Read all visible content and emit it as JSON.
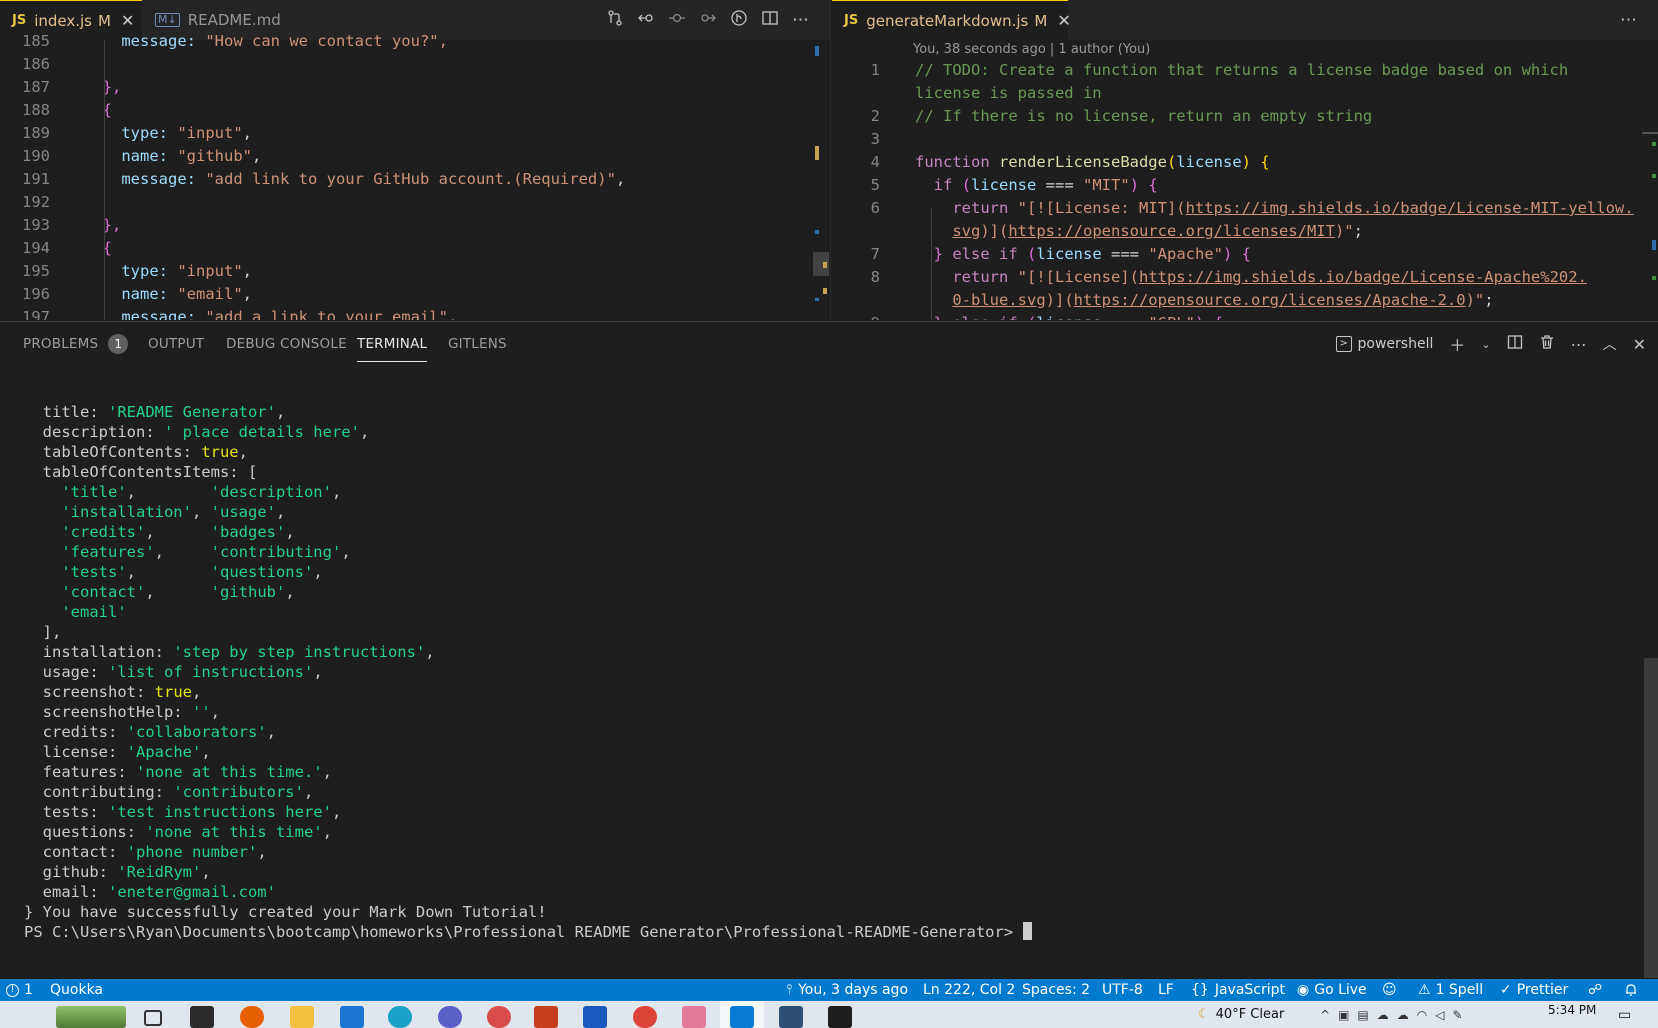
{
  "left_editor": {
    "tabs": [
      {
        "lang": "JS",
        "name": "index.js",
        "status": "M",
        "close": "✕",
        "active": true
      },
      {
        "lang": "M↓",
        "name": "README.md",
        "status": "",
        "close": "",
        "active": false
      }
    ],
    "lines": [
      {
        "n": "185",
        "segs": [
          {
            "t": "    message: ",
            "c": "var"
          },
          {
            "t": "\"How can we contact you?\",",
            "c": "str"
          }
        ]
      },
      {
        "n": "186",
        "segs": []
      },
      {
        "n": "187",
        "segs": [
          {
            "t": "  },",
            "c": "bkt"
          }
        ]
      },
      {
        "n": "188",
        "segs": [
          {
            "t": "  {",
            "c": "bkt"
          }
        ]
      },
      {
        "n": "189",
        "segs": [
          {
            "t": "    type: ",
            "c": "var"
          },
          {
            "t": "\"input\"",
            "c": "str"
          },
          {
            "t": ",",
            "c": "ws"
          }
        ]
      },
      {
        "n": "190",
        "segs": [
          {
            "t": "    name: ",
            "c": "var"
          },
          {
            "t": "\"github\"",
            "c": "str"
          },
          {
            "t": ",",
            "c": "ws"
          }
        ]
      },
      {
        "n": "191",
        "segs": [
          {
            "t": "    message: ",
            "c": "var"
          },
          {
            "t": "\"add link to your GitHub account.(Required)\"",
            "c": "str"
          },
          {
            "t": ",",
            "c": "ws"
          }
        ]
      },
      {
        "n": "192",
        "segs": []
      },
      {
        "n": "193",
        "segs": [
          {
            "t": "  },",
            "c": "bkt"
          }
        ]
      },
      {
        "n": "194",
        "segs": [
          {
            "t": "  {",
            "c": "bkt"
          }
        ]
      },
      {
        "n": "195",
        "segs": [
          {
            "t": "    type: ",
            "c": "var"
          },
          {
            "t": "\"input\"",
            "c": "str"
          },
          {
            "t": ",",
            "c": "ws"
          }
        ]
      },
      {
        "n": "196",
        "segs": [
          {
            "t": "    name: ",
            "c": "var"
          },
          {
            "t": "\"email\"",
            "c": "str"
          },
          {
            "t": ",",
            "c": "ws"
          }
        ]
      },
      {
        "n": "197",
        "segs": [
          {
            "t": "    message: ",
            "c": "var"
          },
          {
            "t": "\"add a link to your email\"",
            "c": "str"
          },
          {
            "t": ",",
            "c": "ws"
          }
        ]
      }
    ]
  },
  "right_editor": {
    "tab": {
      "lang": "JS",
      "name": "generateMarkdown.js",
      "status": "M",
      "close": "✕"
    },
    "codelens": "You, 38 seconds ago | 1 author (You)",
    "lines": [
      {
        "n": "1",
        "segs": [
          {
            "t": "// TODO: Create a function that returns a license badge based on which",
            "c": "cmt"
          }
        ]
      },
      {
        "n": "",
        "segs": [
          {
            "t": "license is passed in",
            "c": "cmt"
          }
        ]
      },
      {
        "n": "2",
        "segs": [
          {
            "t": "// If there is no license, return an empty string",
            "c": "cmt"
          }
        ]
      },
      {
        "n": "3",
        "segs": []
      },
      {
        "n": "4",
        "segs": [
          {
            "t": "function ",
            "c": "kw"
          },
          {
            "t": "renderLicenseBadge",
            "c": "fn"
          },
          {
            "t": "(",
            "c": "bkt2"
          },
          {
            "t": "license",
            "c": "var"
          },
          {
            "t": ") {",
            "c": "bkt2"
          }
        ]
      },
      {
        "n": "5",
        "segs": [
          {
            "t": "  if ",
            "c": "kw"
          },
          {
            "t": "(",
            "c": "bkt"
          },
          {
            "t": "license",
            "c": "var"
          },
          {
            "t": " === ",
            "c": "ws"
          },
          {
            "t": "\"MIT\"",
            "c": "str"
          },
          {
            "t": ") {",
            "c": "bkt"
          }
        ]
      },
      {
        "n": "6",
        "segs": [
          {
            "t": "    return ",
            "c": "kw"
          },
          {
            "t": "\"[![License: MIT](",
            "c": "str"
          },
          {
            "t": "https://img.shields.io/badge/License-MIT-yellow.",
            "c": "url"
          }
        ]
      },
      {
        "n": "",
        "segs": [
          {
            "t": "    ",
            "c": "ws"
          },
          {
            "t": "svg",
            "c": "url"
          },
          {
            "t": ")](",
            "c": "str"
          },
          {
            "t": "https://opensource.org/licenses/MIT",
            "c": "url"
          },
          {
            "t": ")\"",
            "c": "str"
          },
          {
            "t": ";",
            "c": "ws"
          }
        ]
      },
      {
        "n": "7",
        "segs": [
          {
            "t": "  } ",
            "c": "bkt"
          },
          {
            "t": "else if ",
            "c": "kw"
          },
          {
            "t": "(",
            "c": "bkt"
          },
          {
            "t": "license",
            "c": "var"
          },
          {
            "t": " === ",
            "c": "ws"
          },
          {
            "t": "\"Apache\"",
            "c": "str"
          },
          {
            "t": ") {",
            "c": "bkt"
          }
        ]
      },
      {
        "n": "8",
        "segs": [
          {
            "t": "    return ",
            "c": "kw"
          },
          {
            "t": "\"[![License](",
            "c": "str"
          },
          {
            "t": "https://img.shields.io/badge/License-Apache%202.",
            "c": "url"
          }
        ]
      },
      {
        "n": "",
        "segs": [
          {
            "t": "    ",
            "c": "ws"
          },
          {
            "t": "0-blue.svg",
            "c": "url"
          },
          {
            "t": ")](",
            "c": "str"
          },
          {
            "t": "https://opensource.org/licenses/Apache-2.0",
            "c": "url"
          },
          {
            "t": ")\"",
            "c": "str"
          },
          {
            "t": ";",
            "c": "ws"
          }
        ]
      },
      {
        "n": "9",
        "segs": [
          {
            "t": "  } ",
            "c": "bkt"
          },
          {
            "t": "else if ",
            "c": "kw"
          },
          {
            "t": "(",
            "c": "bkt"
          },
          {
            "t": "license",
            "c": "var"
          },
          {
            "t": " === ",
            "c": "ws"
          },
          {
            "t": "\"GPL\"",
            "c": "str"
          },
          {
            "t": ") {",
            "c": "bkt"
          }
        ]
      }
    ]
  },
  "panel": {
    "tabs": [
      {
        "label": "PROBLEMS",
        "badge": "1"
      },
      {
        "label": "OUTPUT",
        "badge": ""
      },
      {
        "label": "DEBUG CONSOLE",
        "badge": ""
      },
      {
        "label": "TERMINAL",
        "badge": ""
      },
      {
        "label": "GITLENS",
        "badge": ""
      }
    ],
    "active_tab": "TERMINAL",
    "shell_name": "powershell"
  },
  "terminal": {
    "lines": [
      [
        {
          "t": "  title: ",
          "c": "tkey"
        },
        {
          "t": "'README Generator'",
          "c": "tstr"
        },
        {
          "t": ",",
          "c": "tkey"
        }
      ],
      [
        {
          "t": "  description: ",
          "c": "tkey"
        },
        {
          "t": "' place details here'",
          "c": "tstr"
        },
        {
          "t": ",",
          "c": "tkey"
        }
      ],
      [
        {
          "t": "  tableOfContents: ",
          "c": "tkey"
        },
        {
          "t": "true",
          "c": "tbool"
        },
        {
          "t": ",",
          "c": "tkey"
        }
      ],
      [
        {
          "t": "  tableOfContentsItems: [",
          "c": "tkey"
        }
      ],
      [
        {
          "t": "    'title'",
          "c": "tstr"
        },
        {
          "t": ",        ",
          "c": "tkey"
        },
        {
          "t": "'description'",
          "c": "tstr"
        },
        {
          "t": ",",
          "c": "tkey"
        }
      ],
      [
        {
          "t": "    'installation'",
          "c": "tstr"
        },
        {
          "t": ", ",
          "c": "tkey"
        },
        {
          "t": "'usage'",
          "c": "tstr"
        },
        {
          "t": ",",
          "c": "tkey"
        }
      ],
      [
        {
          "t": "    'credits'",
          "c": "tstr"
        },
        {
          "t": ",      ",
          "c": "tkey"
        },
        {
          "t": "'badges'",
          "c": "tstr"
        },
        {
          "t": ",",
          "c": "tkey"
        }
      ],
      [
        {
          "t": "    'features'",
          "c": "tstr"
        },
        {
          "t": ",     ",
          "c": "tkey"
        },
        {
          "t": "'contributing'",
          "c": "tstr"
        },
        {
          "t": ",",
          "c": "tkey"
        }
      ],
      [
        {
          "t": "    'tests'",
          "c": "tstr"
        },
        {
          "t": ",        ",
          "c": "tkey"
        },
        {
          "t": "'questions'",
          "c": "tstr"
        },
        {
          "t": ",",
          "c": "tkey"
        }
      ],
      [
        {
          "t": "    'contact'",
          "c": "tstr"
        },
        {
          "t": ",      ",
          "c": "tkey"
        },
        {
          "t": "'github'",
          "c": "tstr"
        },
        {
          "t": ",",
          "c": "tkey"
        }
      ],
      [
        {
          "t": "    'email'",
          "c": "tstr"
        }
      ],
      [
        {
          "t": "  ],",
          "c": "tkey"
        }
      ],
      [
        {
          "t": "  installation: ",
          "c": "tkey"
        },
        {
          "t": "'step by step instructions'",
          "c": "tstr"
        },
        {
          "t": ",",
          "c": "tkey"
        }
      ],
      [
        {
          "t": "  usage: ",
          "c": "tkey"
        },
        {
          "t": "'list of instructions'",
          "c": "tstr"
        },
        {
          "t": ",",
          "c": "tkey"
        }
      ],
      [
        {
          "t": "  screenshot: ",
          "c": "tkey"
        },
        {
          "t": "true",
          "c": "tbool"
        },
        {
          "t": ",",
          "c": "tkey"
        }
      ],
      [
        {
          "t": "  screenshotHelp: ",
          "c": "tkey"
        },
        {
          "t": "''",
          "c": "tstr"
        },
        {
          "t": ",",
          "c": "tkey"
        }
      ],
      [
        {
          "t": "  credits: ",
          "c": "tkey"
        },
        {
          "t": "'collaborators'",
          "c": "tstr"
        },
        {
          "t": ",",
          "c": "tkey"
        }
      ],
      [
        {
          "t": "  license: ",
          "c": "tkey"
        },
        {
          "t": "'Apache'",
          "c": "tstr"
        },
        {
          "t": ",",
          "c": "tkey"
        }
      ],
      [
        {
          "t": "  features: ",
          "c": "tkey"
        },
        {
          "t": "'none at this time.'",
          "c": "tstr"
        },
        {
          "t": ",",
          "c": "tkey"
        }
      ],
      [
        {
          "t": "  contributing: ",
          "c": "tkey"
        },
        {
          "t": "'contributors'",
          "c": "tstr"
        },
        {
          "t": ",",
          "c": "tkey"
        }
      ],
      [
        {
          "t": "  tests: ",
          "c": "tkey"
        },
        {
          "t": "'test instructions here'",
          "c": "tstr"
        },
        {
          "t": ",",
          "c": "tkey"
        }
      ],
      [
        {
          "t": "  questions: ",
          "c": "tkey"
        },
        {
          "t": "'none at this time'",
          "c": "tstr"
        },
        {
          "t": ",",
          "c": "tkey"
        }
      ],
      [
        {
          "t": "  contact: ",
          "c": "tkey"
        },
        {
          "t": "'phone number'",
          "c": "tstr"
        },
        {
          "t": ",",
          "c": "tkey"
        }
      ],
      [
        {
          "t": "  github: ",
          "c": "tkey"
        },
        {
          "t": "'ReidRym'",
          "c": "tstr"
        },
        {
          "t": ",",
          "c": "tkey"
        }
      ],
      [
        {
          "t": "  email: ",
          "c": "tkey"
        },
        {
          "t": "'eneter@gmail.com'",
          "c": "tstr"
        }
      ],
      [
        {
          "t": "} You have successfully created your Mark Down Tutorial!",
          "c": "tkey"
        }
      ],
      [
        {
          "t": "PS C:\\Users\\Ryan\\Documents\\bootcamp\\homeworks\\Professional README Generator\\Professional-README-Generator> ",
          "c": "tkey"
        }
      ]
    ]
  },
  "statusbar": {
    "problems": "1",
    "quokka": "Quokka",
    "blame": "You, 3 days ago",
    "position": "Ln 222, Col 2",
    "spaces": "Spaces: 2",
    "encoding": "UTF-8",
    "eol": "LF",
    "language": "JavaScript",
    "golive": "Go Live",
    "spell": "1 Spell",
    "prettier": "Prettier"
  },
  "taskbar": {
    "weather": "40°F  Clear",
    "time": "5:34 PM"
  },
  "colors": {
    "accent": "#007acc",
    "terminal_string": "#23d18b",
    "modified": "#e2c08d"
  },
  "icons": [
    "source-control-icon",
    "history-back-icon",
    "commit-icon",
    "forward-icon",
    "gitlens-icon",
    "split-editor-icon",
    "more-icon",
    "plus-icon",
    "chevron-down-icon",
    "split-terminal-icon",
    "trash-icon",
    "chevron-up-icon",
    "close-icon",
    "bell-icon"
  ]
}
